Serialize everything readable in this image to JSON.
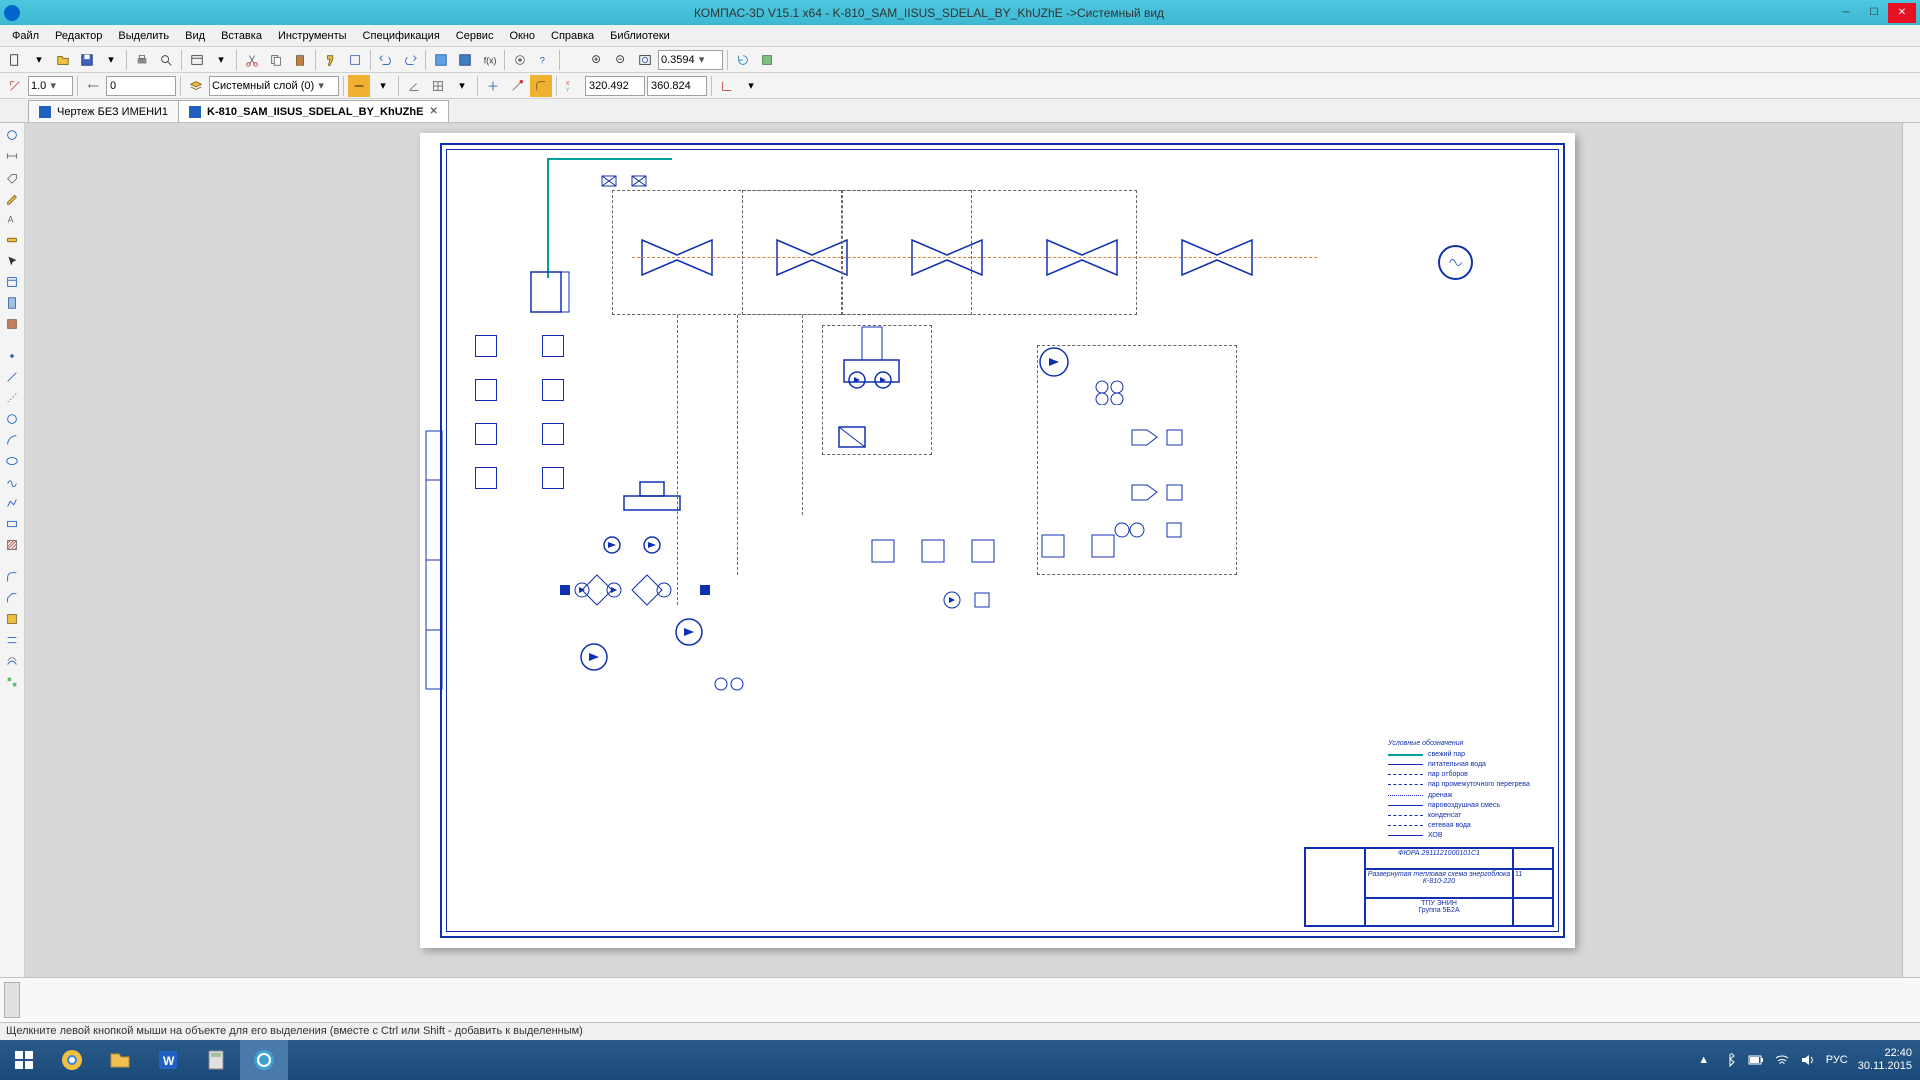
{
  "titlebar": {
    "text": "КОМПАС-3D V15.1 x64 - K-810_SAM_IISUS_SDELAL_BY_KhUZhE ->Системный вид"
  },
  "menu": {
    "items": [
      "Файл",
      "Редактор",
      "Выделить",
      "Вид",
      "Вставка",
      "Инструменты",
      "Спецификация",
      "Сервис",
      "Окно",
      "Справка",
      "Библиотеки"
    ]
  },
  "toolbar1": {
    "zoom_value": "0.3594"
  },
  "toolbar2": {
    "scale_value": "1.0",
    "step_value": "0",
    "layer_label": "Системный слой (0)",
    "coord_x": "320.492",
    "coord_y": "360.824"
  },
  "tabs": [
    {
      "label": "Чертеж БЕЗ ИМЕНИ1",
      "active": false
    },
    {
      "label": "K-810_SAM_IISUS_SDELAL_BY_KhUZhE",
      "active": true
    }
  ],
  "legend": {
    "title": "Условные обозначения",
    "items": [
      "свежий пар",
      "питательная вода",
      "пар отборов",
      "пар промежуточного перегрева",
      "дренаж",
      "паровоздушная смесь",
      "конденсат",
      "сетевая вода",
      "ХОВ"
    ]
  },
  "title_block": {
    "code": "ФЮРА.2911121000101С1",
    "name": "Развернутая тепловая схема энергоблока К-810-220",
    "org1": "ТПУ ЭНИН",
    "org2": "Группа 5Б2А",
    "sheet": "11"
  },
  "statusbar": {
    "hint": "Щелкните левой кнопкой мыши на объекте для его выделения (вместе с Ctrl или Shift - добавить к выделенным)"
  },
  "taskbar": {
    "lang": "РУС",
    "time": "22:40",
    "date": "30.11.2015"
  }
}
